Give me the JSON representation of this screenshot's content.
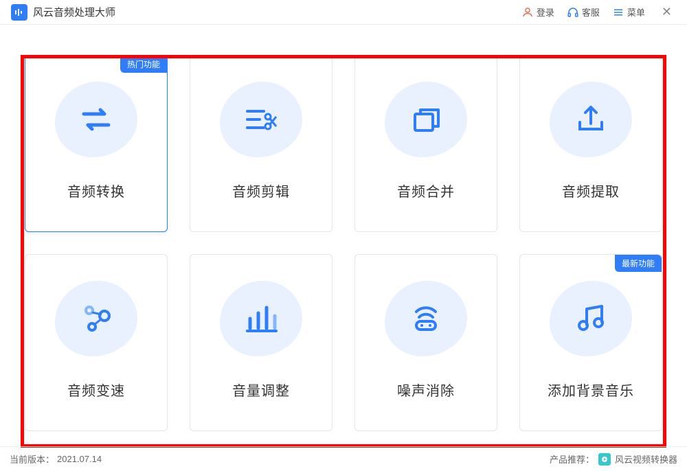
{
  "header": {
    "app_title": "风云音频处理大师",
    "login": "登录",
    "support": "客服",
    "menu": "菜单"
  },
  "badges": {
    "hot": "热门功能",
    "new": "最新功能"
  },
  "cards": [
    {
      "label": "音频转换",
      "badge": "hot",
      "selected": true,
      "icon": "convert-icon"
    },
    {
      "label": "音频剪辑",
      "icon": "cut-icon"
    },
    {
      "label": "音频合并",
      "icon": "merge-icon"
    },
    {
      "label": "音频提取",
      "icon": "extract-icon"
    },
    {
      "label": "音频变速",
      "icon": "speed-icon"
    },
    {
      "label": "音量调整",
      "icon": "volume-icon"
    },
    {
      "label": "噪声消除",
      "icon": "denoise-icon"
    },
    {
      "label": "添加背景音乐",
      "badge": "new",
      "icon": "bgm-icon"
    }
  ],
  "footer": {
    "version_label": "当前版本：",
    "version_value": "2021.07.14",
    "recommend_label": "产品推荐：",
    "recommend_product": "风云视频转换器"
  }
}
